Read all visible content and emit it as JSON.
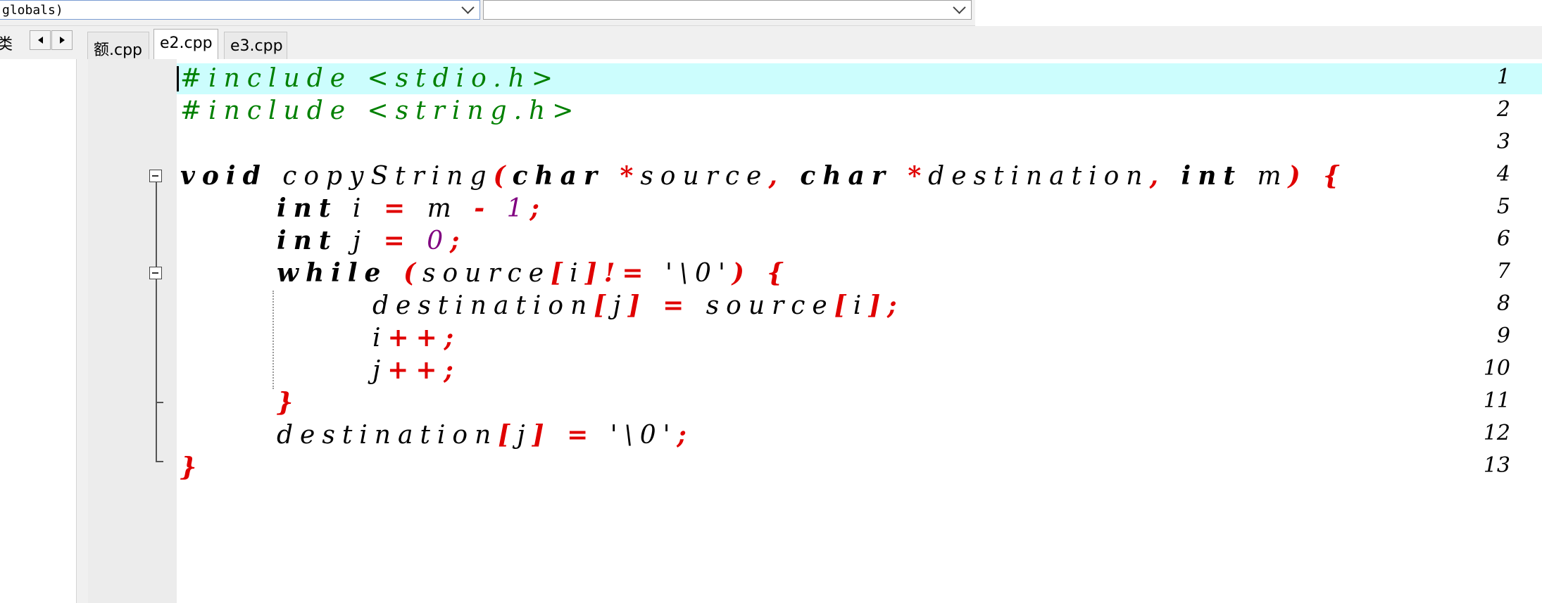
{
  "toolbar": {
    "scope_combo": "globals)",
    "symbol_combo": ""
  },
  "tabs": {
    "left_cut_label": "类",
    "items": [
      {
        "label": "额.cpp",
        "active": false
      },
      {
        "label": "e2.cpp",
        "active": true
      },
      {
        "label": "e3.cpp",
        "active": false
      }
    ]
  },
  "editor": {
    "line_numbers": [
      "1",
      "2",
      "3",
      "4",
      "5",
      "6",
      "7",
      "8",
      "9",
      "10",
      "11",
      "12",
      "13"
    ],
    "colors": {
      "preprocessor": "#008000",
      "keyword": "#000000",
      "operator": "#e00000",
      "number": "#800080",
      "current_line_bg": "#ccfdfd",
      "gutter_bg": "#ececec"
    },
    "code": {
      "l1_pp": "#include <stdio.h>",
      "l2_pp": "#include <string.h>",
      "l4_kw_void": "void",
      "l4_fn": " copyString",
      "l4_op_lparen": "(",
      "l4_kw_char1": "char",
      "l4_op_star1": " *",
      "l4_id_source": "source",
      "l4_op_comma1": ", ",
      "l4_kw_char2": "char",
      "l4_op_star2": " *",
      "l4_id_dest": "destination",
      "l4_op_comma2": ", ",
      "l4_kw_int": "int",
      "l4_id_m": " m",
      "l4_op_rparen": ") {",
      "l5_kw_int": "int",
      "l5_id_i": " i",
      "l5_op_eq": " =",
      "l5_id_m": " m",
      "l5_op_minus": " -",
      "l5_num_1": " 1",
      "l5_op_semi": ";",
      "l6_kw_int": "int",
      "l6_id_j": " j",
      "l6_op_eq": " =",
      "l6_num_0": " 0",
      "l6_op_semi": ";",
      "l7_kw_while": "while",
      "l7_op_lparen": " (",
      "l7_id_source": "source",
      "l7_op_lb": "[",
      "l7_id_i": "i",
      "l7_op_ne": "]!=",
      "l7_id_char": " '\\0'",
      "l7_op_close": ") {",
      "l8_id_dest": "destination",
      "l8_op_lb": "[",
      "l8_id_j": "j",
      "l8_op_rb_eq": "] =",
      "l8_id_source": " source",
      "l8_op_lb2": "[",
      "l8_id_i": "i",
      "l8_op_end": "];",
      "l9_id_i": "i",
      "l9_op": "++;",
      "l10_id_j": "j",
      "l10_op": "++;",
      "l11_op": "}",
      "l12_id_dest": "destination",
      "l12_op_lb": "[",
      "l12_id_j": "j",
      "l12_op_rb_eq": "] =",
      "l12_id_char": " '\\0'",
      "l12_op_semi": ";",
      "l13_op": "}"
    }
  }
}
